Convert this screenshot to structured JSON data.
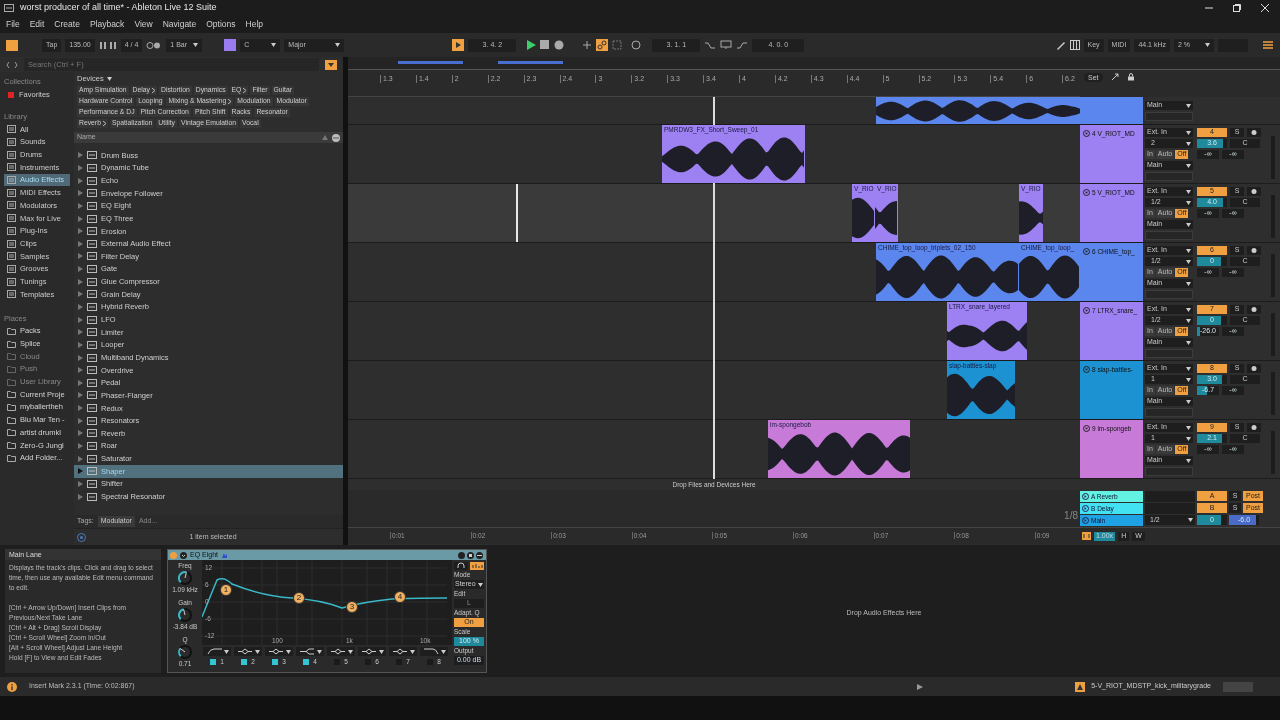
{
  "window": {
    "title": "worst producer of all time* - Ableton Live 12 Suite"
  },
  "menu": [
    "File",
    "Edit",
    "Create",
    "Playback",
    "View",
    "Navigate",
    "Options",
    "Help"
  ],
  "transport": {
    "tap": "Tap",
    "tempo": "135.00",
    "signature": "4 / 4",
    "quantize": "1 Bar",
    "key": "C",
    "scale": "Major",
    "position": "3. 4. 2",
    "loop_start": "3. 1. 1",
    "loop_length": "4. 0. 0",
    "key_map": "Key",
    "midi_map": "MIDI",
    "sample_rate": "44.1 kHz",
    "cpu": "2 %"
  },
  "browser": {
    "search_placeholder": "Search (Ctrl + F)",
    "collections_header": "Collections",
    "collections": [
      {
        "label": "Favorites",
        "color": "#e02424"
      }
    ],
    "library_header": "Library",
    "library": [
      {
        "label": "All",
        "selected": false
      },
      {
        "label": "Sounds",
        "selected": false
      },
      {
        "label": "Drums",
        "selected": false
      },
      {
        "label": "Instruments",
        "selected": false
      },
      {
        "label": "Audio Effects",
        "selected": true
      },
      {
        "label": "MIDI Effects",
        "selected": false
      },
      {
        "label": "Modulators",
        "selected": false
      },
      {
        "label": "Max for Live",
        "selected": false
      },
      {
        "label": "Plug-Ins",
        "selected": false
      },
      {
        "label": "Clips",
        "selected": false
      },
      {
        "label": "Samples",
        "selected": false
      },
      {
        "label": "Grooves",
        "selected": false
      },
      {
        "label": "Tunings",
        "selected": false
      },
      {
        "label": "Templates",
        "selected": false
      }
    ],
    "places_header": "Places",
    "places": [
      {
        "label": "Packs",
        "disabled": false
      },
      {
        "label": "Splice",
        "disabled": false
      },
      {
        "label": "Cloud",
        "disabled": true
      },
      {
        "label": "Push",
        "disabled": true
      },
      {
        "label": "User Library",
        "disabled": true
      },
      {
        "label": "Current Proje",
        "disabled": false
      },
      {
        "label": "myballertheh",
        "disabled": false
      },
      {
        "label": "Blu Mar Ten -",
        "disabled": false
      },
      {
        "label": "artist drumkl",
        "disabled": false
      },
      {
        "label": "Zero-G Jungl",
        "disabled": false
      },
      {
        "label": "Add Folder...",
        "disabled": false
      }
    ],
    "devices_header": "Devices",
    "categories": [
      {
        "label": "Amp Simulation",
        "submenu": false
      },
      {
        "label": "Delay",
        "submenu": true
      },
      {
        "label": "Distortion",
        "submenu": false
      },
      {
        "label": "Dynamics",
        "submenu": false
      },
      {
        "label": "EQ",
        "submenu": true
      },
      {
        "label": "Filter",
        "submenu": false
      },
      {
        "label": "Guitar",
        "submenu": false
      },
      {
        "label": "Hardware Control",
        "submenu": false
      },
      {
        "label": "Looping",
        "submenu": false
      },
      {
        "label": "Mixing & Mastering",
        "submenu": true
      },
      {
        "label": "Modulation",
        "submenu": false
      },
      {
        "label": "Modulator",
        "submenu": false
      },
      {
        "label": "Performance & DJ",
        "submenu": false
      },
      {
        "label": "Pitch Correction",
        "submenu": false
      },
      {
        "label": "Pitch Shift",
        "submenu": false
      },
      {
        "label": "Racks",
        "submenu": false
      },
      {
        "label": "Resonator",
        "submenu": false
      },
      {
        "label": "Reverb",
        "submenu": true
      },
      {
        "label": "Spatialization",
        "submenu": false
      },
      {
        "label": "Utility",
        "submenu": false
      },
      {
        "label": "Vintage Emulation",
        "submenu": false
      },
      {
        "label": "Vocal",
        "submenu": false
      }
    ],
    "column_header": "Name",
    "items": [
      {
        "label": "Drum Buss",
        "selected": false
      },
      {
        "label": "Dynamic Tube",
        "selected": false
      },
      {
        "label": "Echo",
        "selected": false
      },
      {
        "label": "Envelope Follower",
        "selected": false
      },
      {
        "label": "EQ Eight",
        "selected": false
      },
      {
        "label": "EQ Three",
        "selected": false
      },
      {
        "label": "Erosion",
        "selected": false
      },
      {
        "label": "External Audio Effect",
        "selected": false
      },
      {
        "label": "Filter Delay",
        "selected": false
      },
      {
        "label": "Gate",
        "selected": false
      },
      {
        "label": "Glue Compressor",
        "selected": false
      },
      {
        "label": "Grain Delay",
        "selected": false
      },
      {
        "label": "Hybrid Reverb",
        "selected": false
      },
      {
        "label": "LFO",
        "selected": false
      },
      {
        "label": "Limiter",
        "selected": false
      },
      {
        "label": "Looper",
        "selected": false
      },
      {
        "label": "Multiband Dynamics",
        "selected": false
      },
      {
        "label": "Overdrive",
        "selected": false
      },
      {
        "label": "Pedal",
        "selected": false
      },
      {
        "label": "Phaser-Flanger",
        "selected": false
      },
      {
        "label": "Redux",
        "selected": false
      },
      {
        "label": "Resonators",
        "selected": false
      },
      {
        "label": "Reverb",
        "selected": false
      },
      {
        "label": "Roar",
        "selected": false
      },
      {
        "label": "Saturator",
        "selected": false
      },
      {
        "label": "Shaper",
        "selected": true
      },
      {
        "label": "Shifter",
        "selected": false
      },
      {
        "label": "Spectral Resonator",
        "selected": false
      }
    ],
    "tags_label": "Tags:",
    "tag": "Modulator",
    "tag_placeholder": "Add...",
    "status": "1 item selected"
  },
  "arrangement": {
    "set_button": "Set",
    "ruler": [
      "1.3",
      "1.4",
      "2",
      "2.2",
      "2.3",
      "2.4",
      "3",
      "3.2",
      "3.3",
      "3.4",
      "4",
      "4.2",
      "4.3",
      "4.4",
      "5",
      "5.2",
      "5.3",
      "5.4",
      "6",
      "6.2"
    ],
    "top_track": {
      "color": "#5a86ee",
      "output": "Main"
    },
    "tracks": [
      {
        "selected": false,
        "name": "4 V_RIOT_MD",
        "color": "#9d80f2",
        "input": "Ext. In",
        "channel": "2",
        "in": "In",
        "auto": "Auto",
        "off": "Off",
        "output": "Main",
        "number": "4",
        "solo": "S",
        "volume": {
          "value": "3.6",
          "level": 0.85
        },
        "pan": "C",
        "sends": [
          {
            "value": "-∞",
            "level": 0
          },
          {
            "value": "-∞",
            "level": 0
          }
        ],
        "clips": [
          {
            "name": "PMRDW3_FX_Short_Sweep_01"
          }
        ]
      },
      {
        "selected": true,
        "name": "5 V_RIOT_MD",
        "color": "#9d80f2",
        "input": "Ext. In",
        "channel": "1/2",
        "in": "In",
        "auto": "Auto",
        "off": "Off",
        "output": "Main",
        "number": "5",
        "solo": "S",
        "volume": {
          "value": "4.0",
          "level": 0.87
        },
        "pan": "C",
        "sends": [
          {
            "value": "-∞",
            "level": 0
          },
          {
            "value": "-∞",
            "level": 0
          }
        ],
        "clips": [
          {
            "name": "V_RIO"
          },
          {
            "name": "V_RIO"
          },
          {
            "name": "V_RIO"
          }
        ]
      },
      {
        "selected": false,
        "name": "6 CHIME_top_",
        "color": "#5a86ee",
        "input": "Ext. In",
        "channel": "1/2",
        "in": "In",
        "auto": "Auto",
        "off": "Off",
        "output": "Main",
        "number": "6",
        "solo": "S",
        "volume": {
          "value": "0",
          "level": 0.8
        },
        "pan": "C",
        "sends": [
          {
            "value": "-∞",
            "level": 0
          },
          {
            "value": "-∞",
            "level": 0
          }
        ],
        "clips": [
          {
            "name": "CHIME_top_loop_triplets_02_150"
          },
          {
            "name": "CHIME_top_loop_"
          }
        ]
      },
      {
        "selected": false,
        "name": "7 LTRX_snare_",
        "color": "#9d80f2",
        "input": "Ext. In",
        "channel": "1/2",
        "in": "In",
        "auto": "Auto",
        "off": "Off",
        "output": "Main",
        "number": "7",
        "solo": "S",
        "volume": {
          "value": "0",
          "level": 0.8
        },
        "pan": "C",
        "sends": [
          {
            "value": "-26.0",
            "level": 0.15
          },
          {
            "value": "-∞",
            "level": 0
          }
        ],
        "clips": [
          {
            "name": "LTRX_snare_layered"
          }
        ]
      },
      {
        "selected": false,
        "name": "8 slap-battles-",
        "color": "#1c92d2",
        "input": "Ext. In",
        "channel": "1",
        "in": "In",
        "auto": "Auto",
        "off": "Off",
        "output": "Main",
        "number": "8",
        "solo": "S",
        "volume": {
          "value": "3.0",
          "level": 0.84
        },
        "pan": "C",
        "sends": [
          {
            "value": "-6.7",
            "level": 0.45
          },
          {
            "value": "-∞",
            "level": 0
          }
        ],
        "clips": [
          {
            "name": "slap-battles-slap"
          }
        ]
      },
      {
        "selected": false,
        "name": "9 im-spongeb",
        "color": "#c77ad8",
        "input": "Ext. In",
        "channel": "1",
        "in": "In",
        "auto": "Auto",
        "off": "Off",
        "output": "Main",
        "number": "9",
        "solo": "S",
        "volume": {
          "value": "2.1",
          "level": 0.82
        },
        "pan": "C",
        "sends": [
          {
            "value": "-∞",
            "level": 0
          },
          {
            "value": "-∞",
            "level": 0
          }
        ],
        "clips": [
          {
            "name": "im-spongebob"
          }
        ]
      }
    ],
    "drop_hint": "Drop Files and Devices Here",
    "grid": "1/8",
    "returns": [
      {
        "name": "A Reverb",
        "color": "#63f2e2",
        "letter": "A",
        "solo": "S",
        "post": "Post"
      },
      {
        "name": "B Delay",
        "color": "#42e2f2",
        "letter": "B",
        "solo": "S",
        "post": "Post"
      }
    ],
    "main": {
      "name": "Main",
      "color": "#1ea2e4",
      "channel": "1/2",
      "volume": {
        "value": "0",
        "level": 0.8
      },
      "cue": {
        "value": "-6.0",
        "level": 0.9
      }
    },
    "time_ruler": [
      "0:01",
      "0:02",
      "0:03",
      "0:04",
      "0:05",
      "0:06",
      "0:07",
      "0:08",
      "0:09"
    ],
    "zoom": "1.00x",
    "h_button": "H",
    "w_button": "W"
  },
  "info": {
    "title": "Main Lane",
    "paragraphs": [
      "Displays the track's clips. Click and drag to select time, then use any available Edit menu command to edit.",
      "[Ctrl + Arrow Up/Down] Insert Clips from Previous/Next Take Lane",
      "[Ctrl + Alt + Drag] Scroll Display",
      "[Ctrl + Scroll Wheel] Zoom In/Out",
      "[Alt + Scroll Wheel] Adjust Lane Height",
      "Hold [F] to View and Edit Fades"
    ]
  },
  "device": {
    "title": "EQ Eight",
    "on": true,
    "knobs": [
      {
        "label": "Freq",
        "value": "1.09 kHz",
        "level": 0.55
      },
      {
        "label": "Gain",
        "value": "-3.84 dB",
        "level": 0.45
      },
      {
        "label": "Q",
        "value": "0.71",
        "level": 0.3
      }
    ],
    "y_labels": [
      "12",
      "6",
      "0",
      "-6",
      "-12"
    ],
    "x_labels": [
      "100",
      "1k",
      "10k"
    ],
    "points": [
      "1",
      "2",
      "3",
      "4"
    ],
    "bands": [
      {
        "number": "1",
        "kind": "highpass",
        "on": true
      },
      {
        "number": "2",
        "kind": "bell",
        "on": true
      },
      {
        "number": "3",
        "kind": "bell",
        "on": true
      },
      {
        "number": "4",
        "kind": "shelf",
        "on": true
      },
      {
        "number": "5",
        "kind": "bell",
        "on": false
      },
      {
        "number": "6",
        "kind": "bell",
        "on": false
      },
      {
        "number": "7",
        "kind": "bell",
        "on": false
      },
      {
        "number": "8",
        "kind": "lowpass",
        "on": false
      }
    ],
    "mode_label": "Mode",
    "mode": "Stereo",
    "edit_label": "Edit",
    "edit": "L",
    "adapt_label": "Adapt. Q",
    "adapt": "On",
    "scale_label": "Scale",
    "scale": {
      "value": "100 %",
      "level": 1
    },
    "output_label": "Output",
    "output": "0.00 dB"
  },
  "effects_drop_hint": "Drop Audio Effects Here",
  "status": {
    "message": "Insert Mark 2.3.1 (Time: 0:02:867)",
    "current": "5-V_RIOT_MDSTP_kick_militarygrade"
  }
}
